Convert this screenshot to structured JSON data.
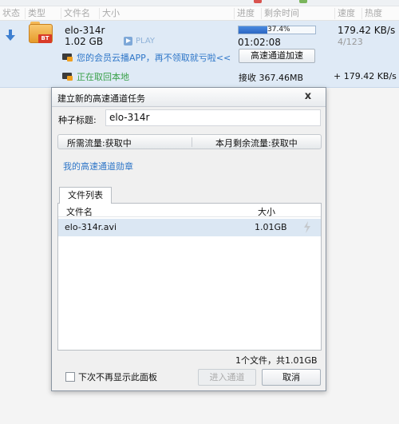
{
  "columns": {
    "status": "状态",
    "type": "类型",
    "filename": "文件名",
    "size": "大小",
    "progress": "进度",
    "remaining": "剩余时间",
    "speed": "速度",
    "heat": "热度"
  },
  "task": {
    "name": "elo-314r",
    "size": "1.02 GB",
    "type_badge": "BT",
    "play_label": "PLAY",
    "progress_percent": "37.4%",
    "progress_value": 37.4,
    "elapsed": "01:02:08",
    "speed": "179.42 KB/s",
    "peers": "4/123",
    "promo_text": "您的会员云播APP，再不领取就亏啦<<",
    "accelerate_button": "高速通道加速",
    "status_text": "正在取回本地",
    "received": "接收 367.46MB",
    "total_speed": "+ 179.42 KB/s"
  },
  "dialog": {
    "title": "建立新的高速通道任务",
    "close_glyph": "x",
    "seed_label": "种子标题:",
    "seed_value": "elo-314r",
    "needed_flow": "所需流量:获取中",
    "monthly_flow": "本月剩余流量:获取中",
    "medal_link": "我的高速通道勋章",
    "tab_label": "文件列表",
    "file_header_name": "文件名",
    "file_header_size": "大小",
    "files": [
      {
        "name": "elo-314r.avi",
        "size": "1.01GB"
      }
    ],
    "summary": "1个文件，共1.01GB",
    "dont_show_label": "下次不再显示此面板",
    "enter_button": "进入通道",
    "cancel_button": "取消"
  },
  "colors": {
    "row_highlight": "#dfeaf6",
    "progress_fill": "#2c66c2",
    "link": "#2e76c8",
    "status_green": "#3aa14a",
    "bt_badge": "#d93b28"
  }
}
